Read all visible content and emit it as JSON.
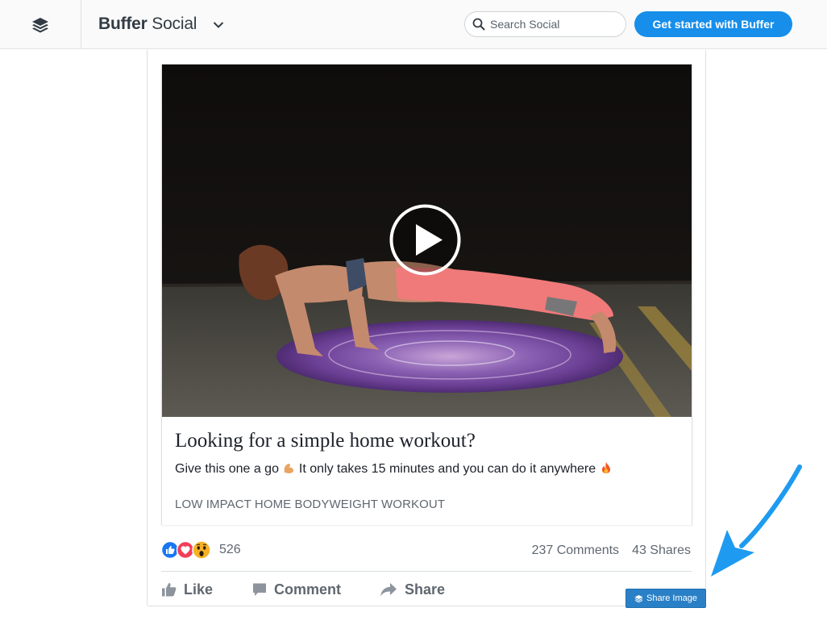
{
  "header": {
    "brand_bold": "Buffer",
    "brand_regular": " Social",
    "search_placeholder": "Search Social",
    "cta_label": "Get started with Buffer",
    "logo_icon": "buffer-stack-icon",
    "dropdown_icon": "chevron-down-icon",
    "search_icon": "search-icon"
  },
  "post": {
    "link_title": "Looking for a simple home workout?",
    "link_desc_part1": "Give this one a go ",
    "link_desc_part2": " It only takes 15 minutes and you can do it anywhere ",
    "emoji_1": "flexed-biceps-emoji",
    "emoji_2": "fire-emoji",
    "link_domain": "LOW IMPACT HOME BODYWEIGHT WORKOUT",
    "reaction_count": "526",
    "comments": "237 Comments",
    "shares": "43 Shares",
    "actions": {
      "like": "Like",
      "comment": "Comment",
      "share": "Share"
    }
  },
  "overlay": {
    "share_image_label": "Share Image"
  },
  "colors": {
    "primary": "#168eea",
    "share_button": "#2a80c6",
    "arrow": "#1e9bf0",
    "text": "#1d2129",
    "muted": "#606770"
  }
}
